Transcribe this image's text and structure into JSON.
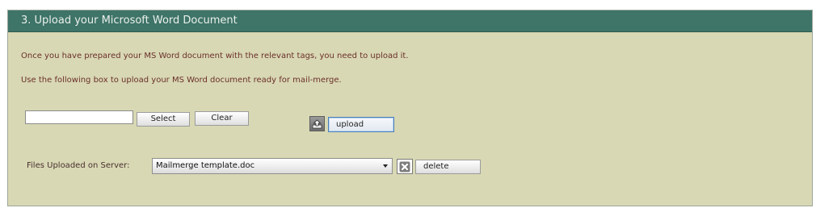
{
  "section": {
    "title": "3. Upload your Microsoft Word Document"
  },
  "instructions": {
    "line1": "Once you have prepared your MS Word document with the relevant tags, you need to upload it.",
    "line2": "Use the following box to upload your MS Word document ready for mail-merge."
  },
  "file_picker": {
    "value": "",
    "select_label": "Select",
    "clear_label": "Clear"
  },
  "upload": {
    "icon": "upload-icon",
    "label": "upload"
  },
  "server_files": {
    "label": "Files Uploaded on Server:",
    "selected": "Mailmerge template.doc",
    "delete_icon": "close-icon",
    "delete_label": "delete"
  },
  "colors": {
    "header_bg": "#3f7468",
    "panel_bg": "#d8d8b4",
    "text_brown": "#6b2f2a"
  }
}
